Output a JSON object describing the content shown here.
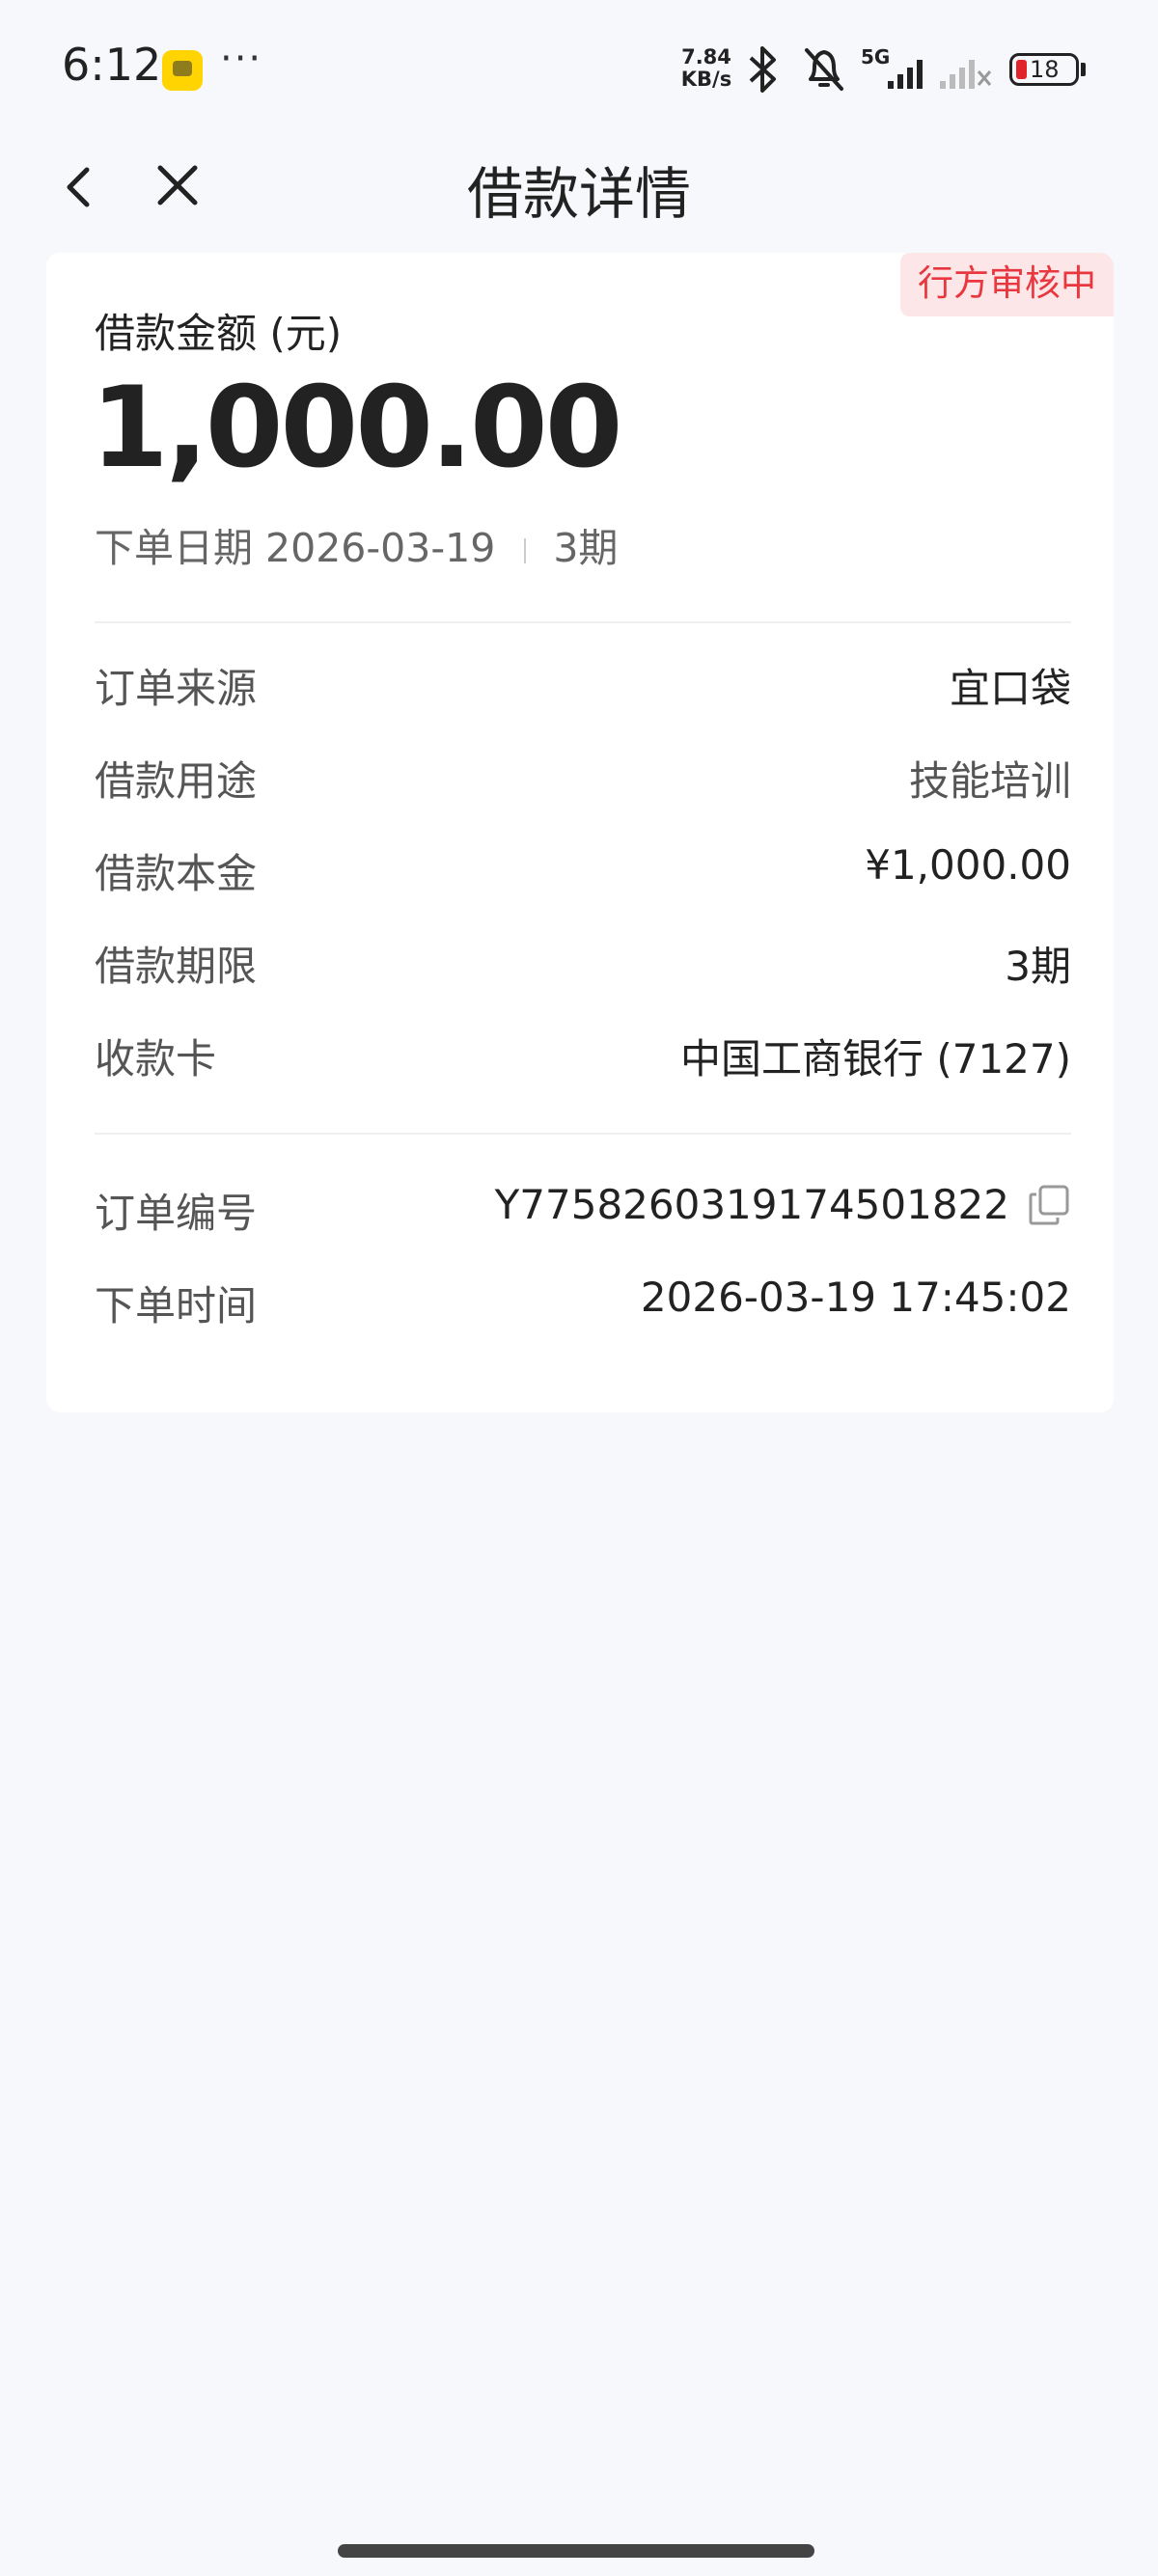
{
  "status_bar": {
    "time": "6:12",
    "more": "···",
    "net_speed_value": "7.84",
    "net_speed_unit": "KB/s",
    "network": "5G",
    "battery": "18",
    "icons": [
      "app-notification-icon",
      "bluetooth-icon",
      "bell-muted-icon",
      "signal-icon",
      "signal-no-service-icon",
      "battery-icon"
    ]
  },
  "nav": {
    "title": "借款详情",
    "back_icon": "chevron-left-icon",
    "close_icon": "close-icon"
  },
  "loan": {
    "status_badge": "行方审核中",
    "amount_label": "借款金额 (元)",
    "amount": "1,000.00",
    "date_label": "下单日期",
    "date": "2026-03-19",
    "periods": "3期",
    "details": [
      {
        "label": "订单来源",
        "value": "宜口袋"
      },
      {
        "label": "借款用途",
        "value": "技能培训"
      },
      {
        "label": "借款本金",
        "value": "¥1,000.00"
      },
      {
        "label": "借款期限",
        "value": "3期"
      },
      {
        "label": "收款卡",
        "value": "中国工商银行 (7127)"
      }
    ],
    "order": [
      {
        "label": "订单编号",
        "value": "Y775826031917450182​2"
      },
      {
        "label": "下单时间",
        "value": "2026-03-19 17:45:02"
      }
    ],
    "copy_icon": "copy-icon"
  },
  "colors": {
    "background": "#f7f8fc",
    "badge_bg": "#fde6e7",
    "badge_text": "#e8373f",
    "battery_low": "#e0242c"
  }
}
